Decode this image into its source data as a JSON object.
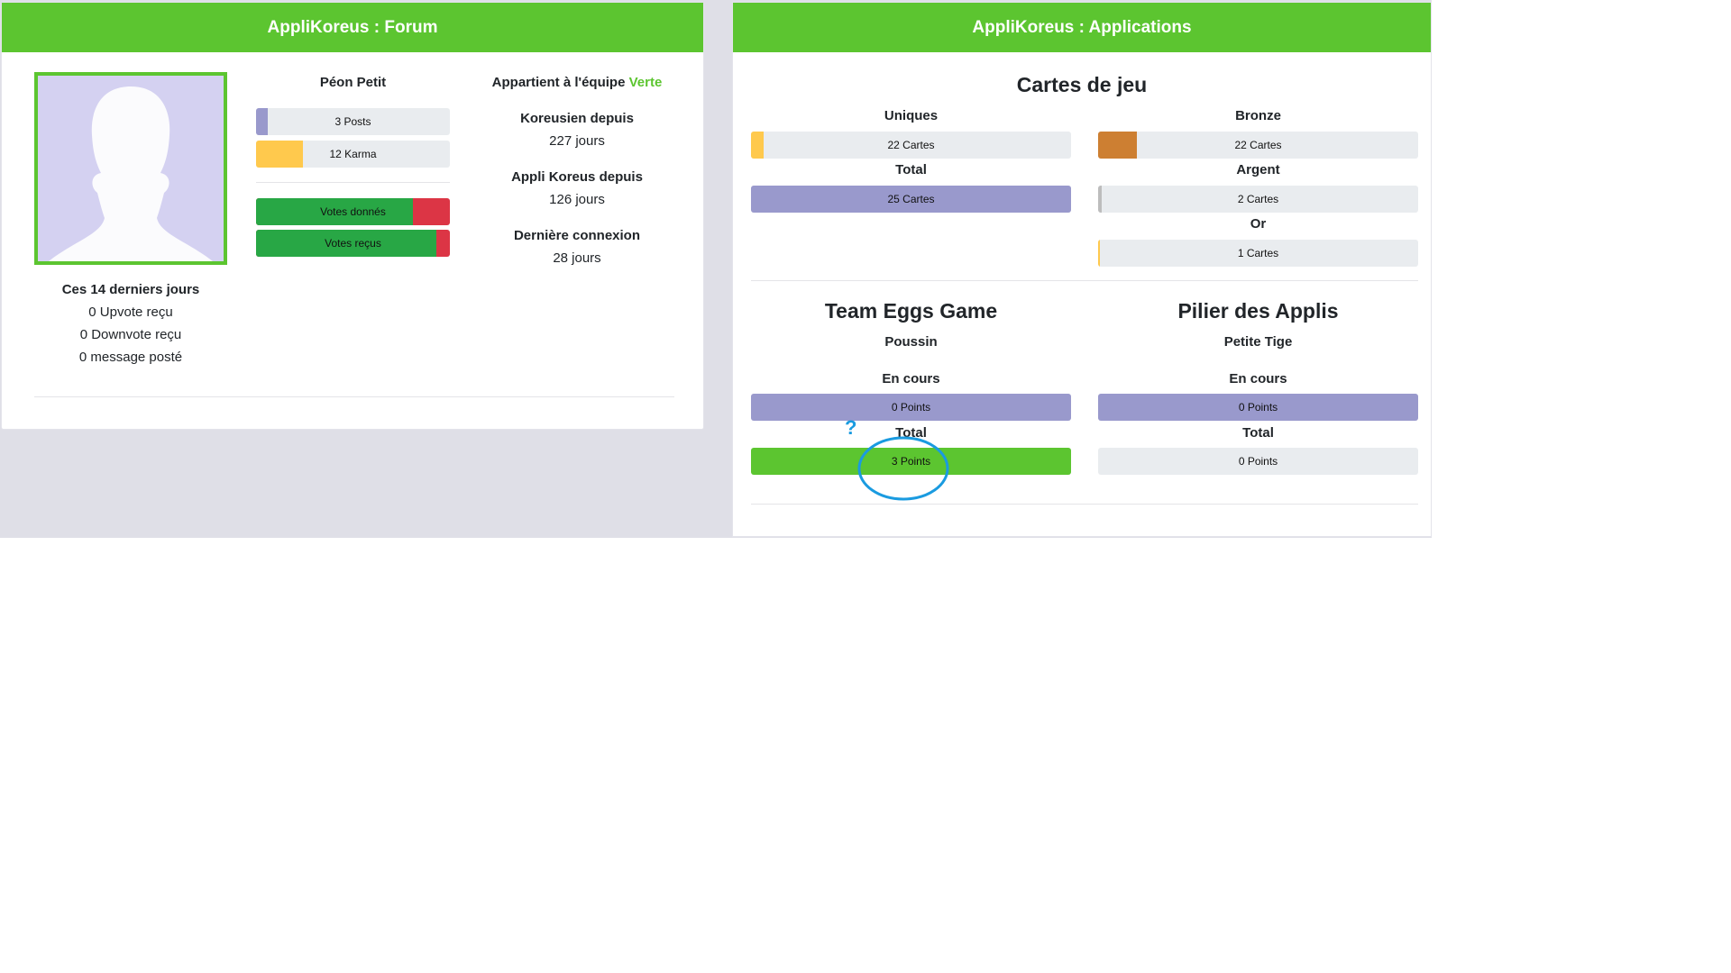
{
  "colors": {
    "header": "#5cc530",
    "purple": "#9999cc",
    "yellow": "#ffc94d",
    "bronze": "#cd7f32",
    "silver": "#bdbdbd",
    "red": "#dc3545",
    "green_bar": "#28a745",
    "bright_green": "#5cc530",
    "bar_bg": "#e9ecef",
    "annotation": "#1a9be0"
  },
  "forum": {
    "title": "AppliKoreus : Forum",
    "username": "Péon Petit",
    "posts": {
      "label": "3 Posts",
      "fill": 0.06
    },
    "karma": {
      "label": "12 Karma",
      "fill": 0.24
    },
    "votes_given": {
      "label": "Votes donnés",
      "positive": 0.81
    },
    "votes_received": {
      "label": "Votes reçus",
      "positive": 0.93
    },
    "team_prefix": "Appartient à l'équipe",
    "team_name": "Verte",
    "member_since_label": "Koreusien depuis",
    "member_since_value": "227 jours",
    "app_since_label": "Appli Koreus depuis",
    "app_since_value": "126 jours",
    "last_login_label": "Dernière connexion",
    "last_login_value": "28 jours",
    "recent_title": "Ces 14 derniers jours",
    "recent_upvotes": "0 Upvote reçu",
    "recent_downvotes": "0 Downvote reçu",
    "recent_messages": "0 message posté"
  },
  "apps": {
    "title": "AppliKoreus : Applications",
    "cards_title": "Cartes de jeu",
    "uniques": {
      "label": "Uniques",
      "value": "22 Cartes",
      "fill": 0.04
    },
    "total": {
      "label": "Total",
      "value": "25 Cartes",
      "fill": 1.0
    },
    "bronze": {
      "label": "Bronze",
      "value": "22 Cartes",
      "fill": 0.12
    },
    "argent": {
      "label": "Argent",
      "value": "2 Cartes",
      "fill": 0.01
    },
    "or": {
      "label": "Or",
      "value": "1 Cartes",
      "fill": 0.005
    },
    "eggs": {
      "title": "Team Eggs Game",
      "rank": "Poussin",
      "current_label": "En cours",
      "current_value": "0 Points",
      "total_label": "Total",
      "total_value": "3 Points"
    },
    "pilier": {
      "title": "Pilier des Applis",
      "rank": "Petite Tige",
      "current_label": "En cours",
      "current_value": "0 Points",
      "total_label": "Total",
      "total_value": "0 Points"
    },
    "annotation_mark": "?"
  }
}
